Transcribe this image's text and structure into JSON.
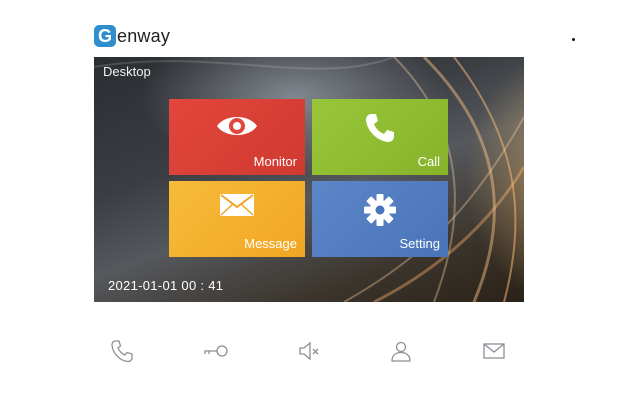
{
  "brand": {
    "initial": "G",
    "rest": "enway"
  },
  "screen": {
    "title": "Desktop",
    "datetime": "2021-01-01   00 : 41"
  },
  "tiles": [
    {
      "label": "Monitor",
      "icon": "eye-icon",
      "color": "#e2463c"
    },
    {
      "label": "Call",
      "icon": "phone-icon",
      "color": "#98c63a"
    },
    {
      "label": "Message",
      "icon": "envelope-icon",
      "color": "#f7bb3a"
    },
    {
      "label": "Setting",
      "icon": "gear-icon",
      "color": "#5c86c8"
    }
  ],
  "hardware_buttons": [
    {
      "icon": "phone-icon"
    },
    {
      "icon": "key-icon"
    },
    {
      "icon": "mute-icon"
    },
    {
      "icon": "user-icon"
    },
    {
      "icon": "mail-icon"
    }
  ]
}
